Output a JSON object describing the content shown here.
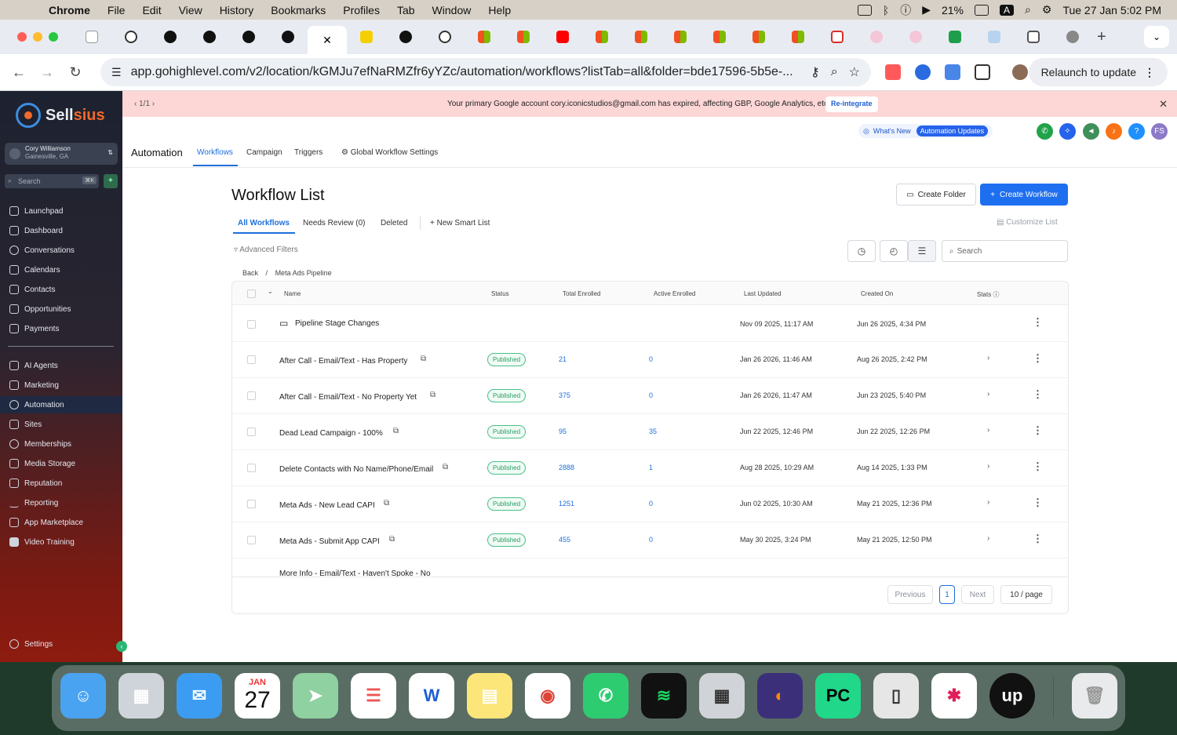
{
  "menubar": {
    "apple": "",
    "app": "Chrome",
    "items": [
      "File",
      "Edit",
      "View",
      "History",
      "Bookmarks",
      "Profiles",
      "Tab",
      "Window",
      "Help"
    ],
    "battery": "21%",
    "input": "A",
    "datetime": "Tue 27 Jan  5:02 PM"
  },
  "browser": {
    "url": "app.gohighlevel.com/v2/location/kGMJu7efNaRMZfr6yYZc/automation/workflows?listTab=all&folder=bde17596-5b5e-...",
    "relaunch": "Relaunch to update"
  },
  "sidebar": {
    "brand_a": "Sell",
    "brand_b": "sius",
    "account_name": "Cory Williamson",
    "account_loc": "Gainesville, GA",
    "search": "Search",
    "search_kbd": "⌘K",
    "nav_top": [
      "Launchpad",
      "Dashboard",
      "Conversations",
      "Calendars",
      "Contacts",
      "Opportunities",
      "Payments"
    ],
    "nav_bottom": [
      "AI Agents",
      "Marketing",
      "Automation",
      "Sites",
      "Memberships",
      "Media Storage",
      "Reputation",
      "Reporting",
      "App Marketplace",
      "Video Training"
    ],
    "settings": "Settings"
  },
  "banner": {
    "pager": "1/1",
    "message": "Your primary Google account cory.iconicstudios@gmail.com has expired, affecting GBP, Google Analytics, etc.",
    "button": "Re-integrate"
  },
  "topstrip": {
    "whats_new": "What's New",
    "updates": "Automation Updates",
    "avatar": "FS"
  },
  "header": {
    "title": "Automation",
    "tabs": [
      "Workflows",
      "Campaign",
      "Triggers",
      "Global Workflow Settings"
    ]
  },
  "list": {
    "title": "Workflow List",
    "create_folder": "Create Folder",
    "create_workflow": "Create Workflow",
    "tabs": [
      "All Workflows",
      "Needs Review (0)",
      "Deleted"
    ],
    "new_smart_list": "New Smart List",
    "customize": "Customize List",
    "advanced_filters": "Advanced Filters",
    "search": "Search",
    "crumb_back": "Back",
    "crumb_sep": "/",
    "crumb_folder": "Meta Ads Pipeline"
  },
  "table": {
    "headers": [
      "Name",
      "Status",
      "Total Enrolled",
      "Active Enrolled",
      "Last Updated",
      "Created On",
      "Stats"
    ],
    "rows": [
      {
        "name": "Pipeline Stage Changes",
        "status": "",
        "total": "",
        "active": "",
        "updated": "Nov 09 2025, 11:17 AM",
        "created": "Jun 26 2025, 4:34 PM"
      },
      {
        "name": "After Call - Email/Text - Has Property",
        "status": "Published",
        "total": "21",
        "active": "0",
        "updated": "Jan 26 2026, 11:46 AM",
        "created": "Aug 26 2025, 2:42 PM"
      },
      {
        "name": "After Call - Email/Text - No Property Yet",
        "status": "Published",
        "total": "375",
        "active": "0",
        "updated": "Jan 26 2026, 11:47 AM",
        "created": "Jun 23 2025, 5:40 PM"
      },
      {
        "name": "Dead Lead Campaign - 100%",
        "status": "Published",
        "total": "95",
        "active": "35",
        "updated": "Jun 22 2025, 12:46 PM",
        "created": "Jun 22 2025, 12:26 PM"
      },
      {
        "name": "Delete Contacts with No Name/Phone/Email",
        "status": "Published",
        "total": "2888",
        "active": "1",
        "updated": "Aug 28 2025, 10:29 AM",
        "created": "Aug 14 2025, 1:33 PM"
      },
      {
        "name": "Meta Ads - New Lead CAPI",
        "status": "Published",
        "total": "1251",
        "active": "0",
        "updated": "Jun 02 2025, 10:30 AM",
        "created": "May 21 2025, 12:36 PM"
      },
      {
        "name": "Meta Ads - Submit App CAPI",
        "status": "Published",
        "total": "455",
        "active": "0",
        "updated": "May 30 2025, 3:24 PM",
        "created": "May 21 2025, 12:50 PM"
      },
      {
        "name": "More Info - Email/Text - Haven't Spoke - No",
        "status": "",
        "total": "",
        "active": "",
        "updated": "",
        "created": ""
      }
    ]
  },
  "pagination": {
    "prev": "Previous",
    "page": "1",
    "next": "Next",
    "per_page": "10 / page"
  },
  "dock": {
    "calendar_month": "JAN",
    "calendar_day": "27"
  }
}
